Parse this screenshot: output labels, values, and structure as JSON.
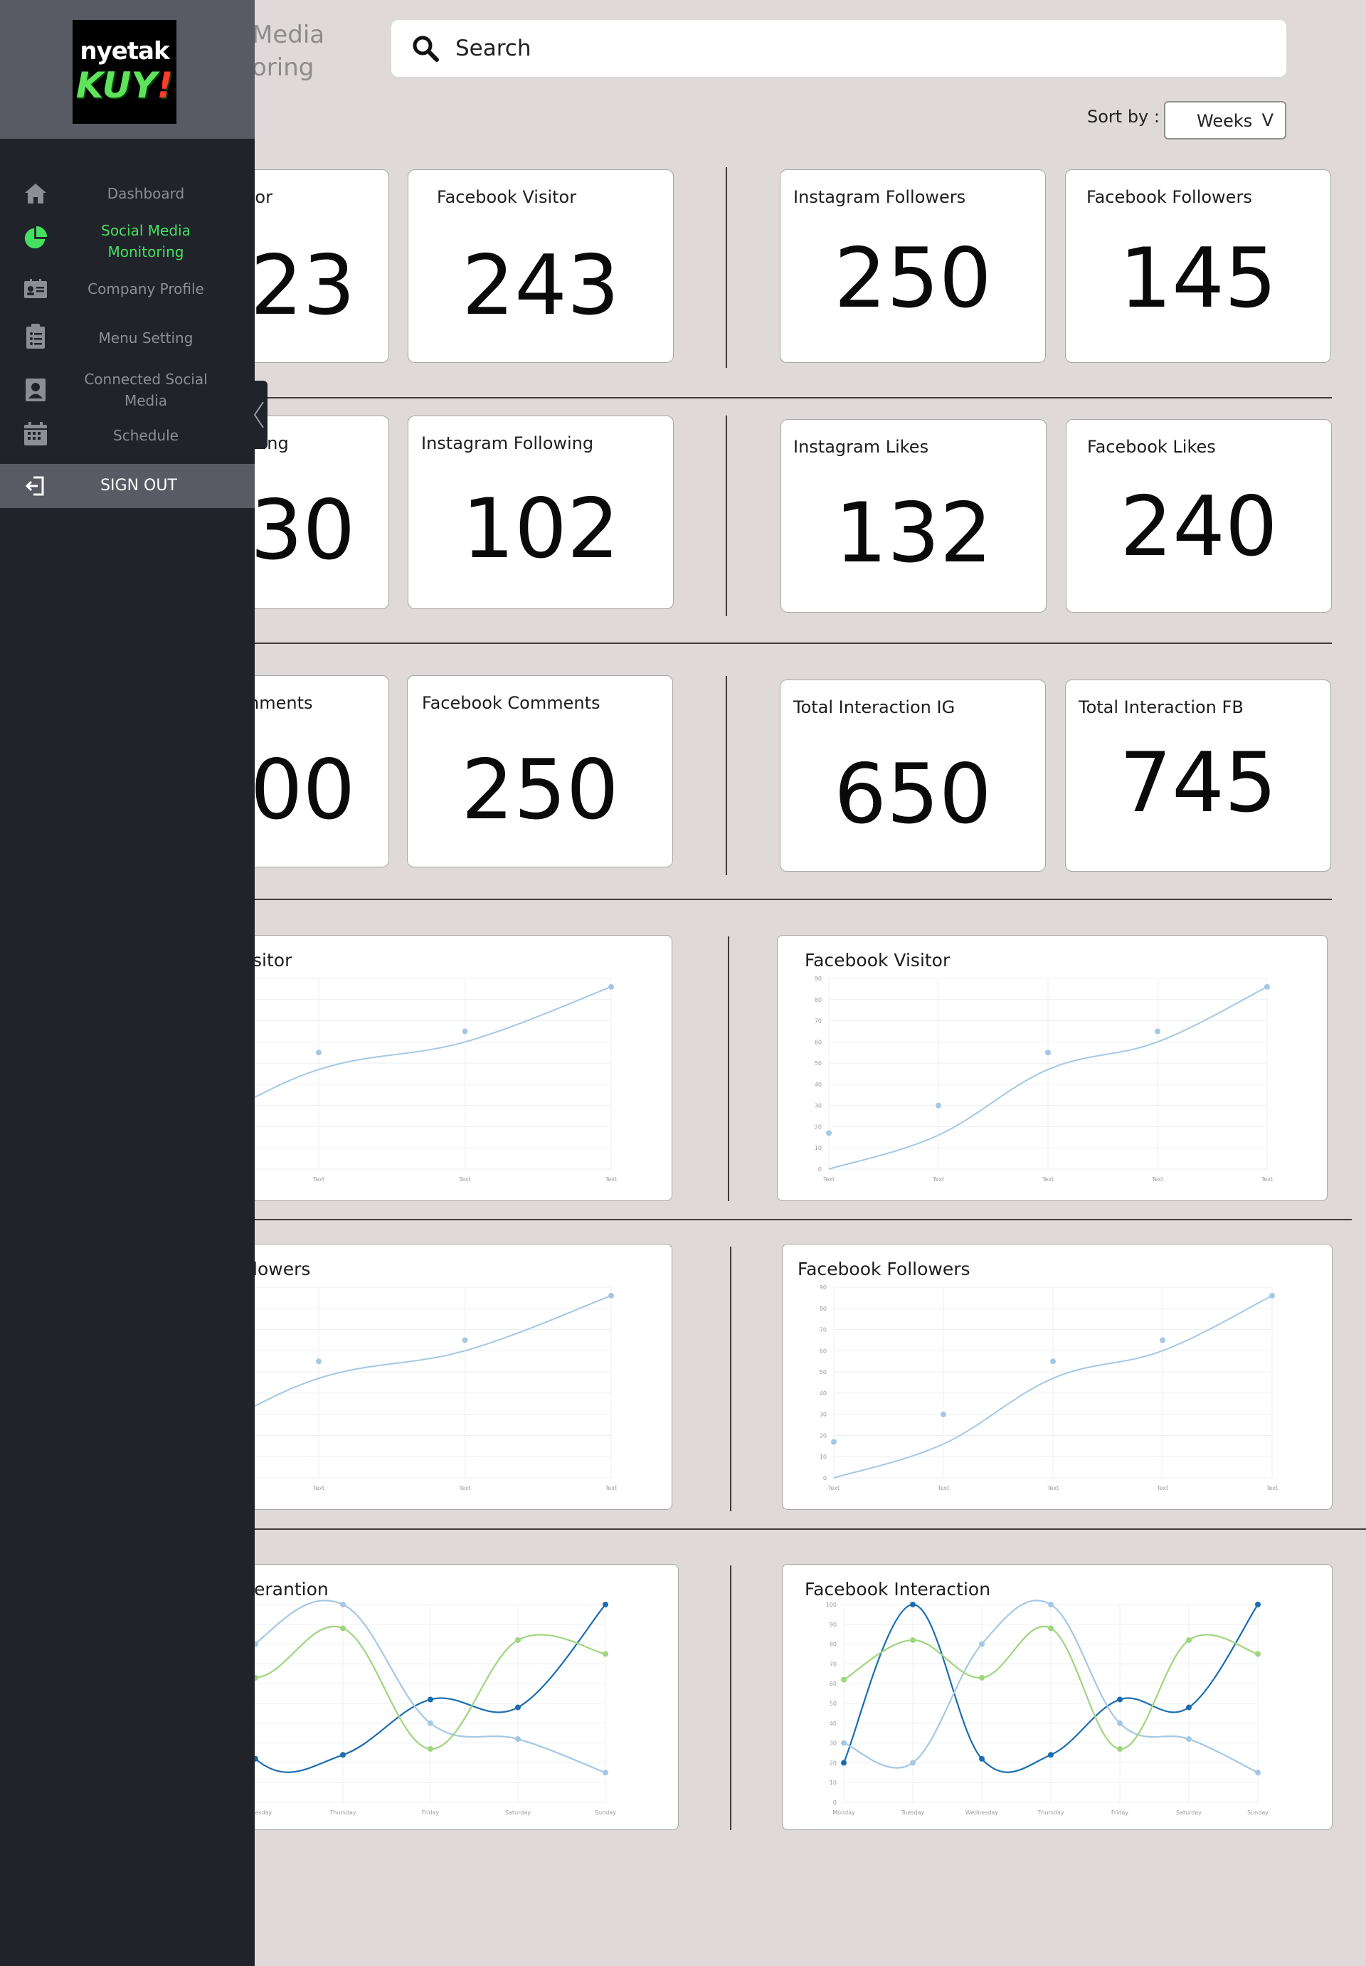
{
  "app": {
    "logo_line1": "nyetak",
    "logo_line2": "KUY",
    "logo_bang": "!"
  },
  "sidebar": {
    "items": [
      {
        "label": "Dashboard",
        "icon": "home-icon",
        "active": false
      },
      {
        "label": "Social Media Monitoring",
        "icon": "pie-chart-icon",
        "active": true
      },
      {
        "label": "Company Profile",
        "icon": "id-card-icon",
        "active": false
      },
      {
        "label": "Menu Setting",
        "icon": "clipboard-list-icon",
        "active": false
      },
      {
        "label": "Connected Social Media",
        "icon": "contact-book-icon",
        "active": false
      },
      {
        "label": "Schedule",
        "icon": "calendar-icon",
        "active": false
      }
    ],
    "signout_label": "SIGN OUT",
    "active_color": "#45e062"
  },
  "header": {
    "page_title_peek": "Media\noring",
    "search_placeholder": "Search",
    "sort_label": "Sort by :",
    "sort_value": "Weeks",
    "sort_chevron": "V"
  },
  "stats": {
    "row1": [
      {
        "label": "tor",
        "value": "23"
      },
      {
        "label": "Facebook Visitor",
        "value": "243"
      },
      {
        "label": "Instagram Followers",
        "value": "250"
      },
      {
        "label": "Facebook Followers",
        "value": "145"
      }
    ],
    "row2": [
      {
        "label": "wing",
        "value": "30"
      },
      {
        "label": "Instagram Following",
        "value": "102"
      },
      {
        "label": "Instagram Likes",
        "value": "132"
      },
      {
        "label": "Facebook Likes",
        "value": "240"
      }
    ],
    "row3": [
      {
        "label": "nments",
        "value": "00"
      },
      {
        "label": "Facebook Comments",
        "value": "250"
      },
      {
        "label": "Total Interaction IG",
        "value": "650"
      },
      {
        "label": "Total Interaction FB",
        "value": "745"
      }
    ]
  },
  "charts": {
    "visitor_left_title": "sitor",
    "visitor_right_title": "Facebook Visitor",
    "followers_left_title": "lowers",
    "followers_right_title": "Facebook Followers",
    "interaction_left_title": "erantion",
    "interaction_right_title": "Facebook Interaction"
  },
  "chart_data": [
    {
      "type": "line",
      "title": "Facebook Visitor",
      "categories": [
        "Text",
        "Text",
        "Text",
        "Text",
        "Text"
      ],
      "series": [
        {
          "values": [
            0,
            16,
            47,
            60,
            86
          ]
        },
        {
          "values": [
            17,
            30,
            55,
            65,
            86
          ]
        }
      ],
      "ylim": [
        0,
        90
      ],
      "yticks": [
        0,
        10,
        20,
        30,
        40,
        50,
        60,
        70,
        80,
        90
      ],
      "grid": true,
      "color": "#a4c8e4"
    },
    {
      "type": "line",
      "title": "Facebook Followers",
      "categories": [
        "Text",
        "Text",
        "Text",
        "Text",
        "Text"
      ],
      "series": [
        {
          "values": [
            0,
            16,
            47,
            60,
            86
          ]
        },
        {
          "values": [
            17,
            30,
            55,
            65,
            86
          ]
        }
      ],
      "ylim": [
        0,
        90
      ],
      "yticks": [
        0,
        10,
        20,
        30,
        40,
        50,
        60,
        70,
        80,
        90
      ],
      "grid": true,
      "color": "#a4c8e4"
    },
    {
      "type": "line",
      "title": "Facebook Interaction",
      "categories": [
        "Monday",
        "Tuesday",
        "Wednesday",
        "Thursday",
        "Friday",
        "Saturday",
        "Sunday"
      ],
      "series": [
        {
          "values": [
            20,
            100,
            22,
            24,
            52,
            48,
            100
          ],
          "color": "#1c6db0"
        },
        {
          "values": [
            30,
            20,
            80,
            100,
            40,
            32,
            15
          ],
          "color": "#a4c8e4"
        },
        {
          "values": [
            62,
            82,
            63,
            88,
            27,
            82,
            75
          ],
          "color": "#9ed57e"
        }
      ],
      "ylim": [
        0,
        100
      ],
      "yticks": [
        0,
        10,
        20,
        30,
        40,
        50,
        60,
        70,
        80,
        90,
        100
      ],
      "grid": true
    }
  ]
}
